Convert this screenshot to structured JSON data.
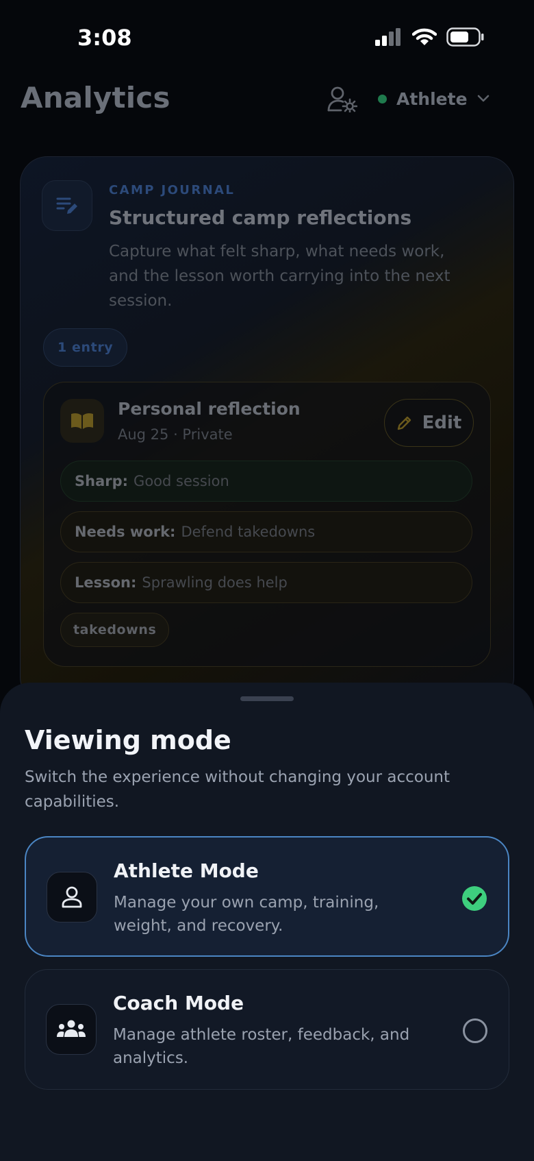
{
  "status_bar": {
    "time": "3:08"
  },
  "header": {
    "title": "Analytics",
    "mode_label": "Athlete"
  },
  "journal": {
    "kicker": "CAMP JOURNAL",
    "title": "Structured camp reflections",
    "description": "Capture what felt sharp, what needs work, and the lesson worth carrying into the next session.",
    "entry_count": "1 entry",
    "entry": {
      "title": "Personal reflection",
      "meta": "Aug 25 · Private",
      "edit_label": "Edit",
      "sharp_key": "Sharp:",
      "sharp_value": "Good session",
      "work_key": "Needs work:",
      "work_value": "Defend takedowns",
      "lesson_key": "Lesson:",
      "lesson_value": "Sprawling does help",
      "tag": "takedowns"
    }
  },
  "sheet": {
    "title": "Viewing mode",
    "subtitle": "Switch the experience without changing your account capabilities.",
    "options": [
      {
        "title": "Athlete Mode",
        "description": "Manage your own camp, training, weight, and recovery.",
        "selected": true
      },
      {
        "title": "Coach Mode",
        "description": "Manage athlete roster, feedback, and analytics.",
        "selected": false
      }
    ]
  },
  "colors": {
    "accent_blue": "#4b86c4",
    "check_green": "#3ecf7e",
    "status_dot": "#1f7a4d"
  }
}
